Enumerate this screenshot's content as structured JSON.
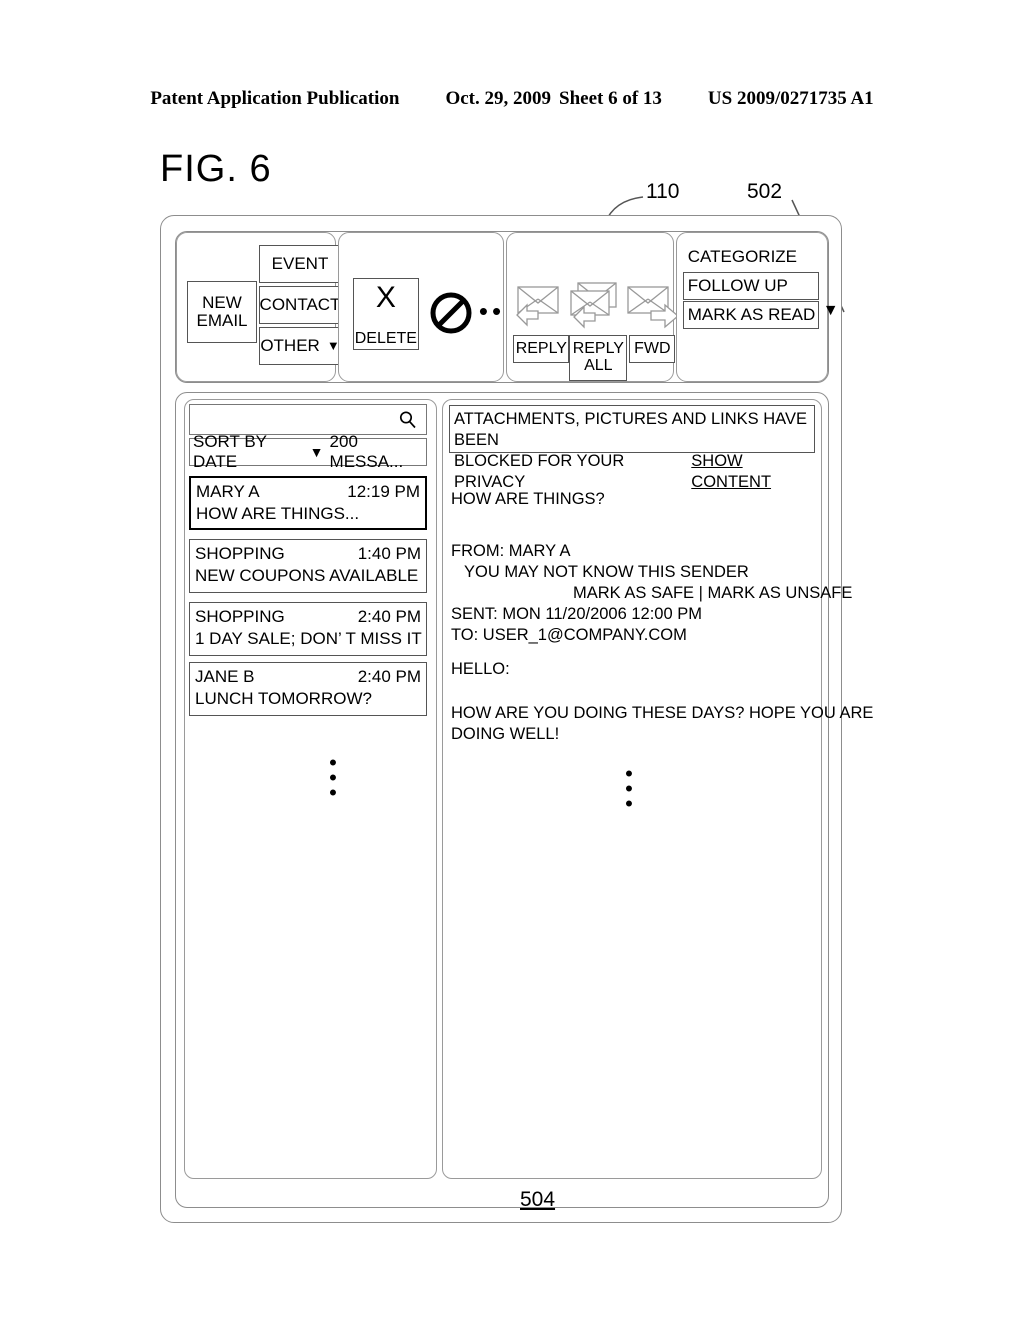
{
  "patent_header": {
    "publication": "Patent Application Publication",
    "date": "Oct. 29, 2009",
    "sheet": "Sheet 6 of 13",
    "number": "US 2009/0271735 A1"
  },
  "figure": {
    "label": "FIG. 6",
    "refs": {
      "device_frame": "110",
      "categorize_dropdown": "502",
      "content_area": "504"
    }
  },
  "ribbon": {
    "new_group": {
      "new_email": "NEW\nEMAIL",
      "new_email_line1": "NEW",
      "new_email_line2": "EMAIL",
      "event": "EVENT",
      "contact": "CONTACT",
      "other": "OTHER",
      "other_caret": "▼"
    },
    "delete_group": {
      "delete_glyph": "X",
      "delete_label": "DELETE",
      "junk_icon": "no-entry-icon",
      "overflow": "•••"
    },
    "reply_group": {
      "reply": "REPLY",
      "reply_all_line1": "REPLY",
      "reply_all_line2": "ALL",
      "fwd": "FWD"
    },
    "categorize_group": {
      "categorize": "CATEGORIZE",
      "follow_up": "FOLLOW UP",
      "mark_as_read": "MARK AS READ",
      "caret": "▼"
    }
  },
  "list_pane": {
    "search_placeholder": "",
    "search_value": "",
    "sort_label": "SORT BY DATE",
    "sort_caret": "▼",
    "count_label": "200 MESSA...",
    "ellipsis": "•\n•\n•",
    "messages": [
      {
        "sender": "MARY A",
        "time": "12:19 PM",
        "preview": "HOW ARE THINGS...",
        "selected": true
      },
      {
        "sender": "SHOPPING",
        "time": "1:40 PM",
        "preview": "NEW COUPONS AVAILABLE",
        "selected": false
      },
      {
        "sender": "SHOPPING",
        "time": "2:40 PM",
        "preview": "1 DAY SALE; DON’   T MISS IT",
        "selected": false
      },
      {
        "sender": "JANE B",
        "time": "2:40 PM",
        "preview": "LUNCH TOMORROW?",
        "selected": false
      }
    ]
  },
  "reading_pane": {
    "blocked_line1": "ATTACHMENTS, PICTURES AND LINKS HAVE BEEN",
    "blocked_line2": "BLOCKED FOR YOUR PRIVACY",
    "show_content": "SHOW CONTENT",
    "subject": "HOW ARE THINGS?",
    "from": "FROM: MARY A",
    "unknown_sender": "YOU MAY NOT KNOW THIS SENDER",
    "mark_safe": "MARK AS SAFE | MARK AS UNSAFE",
    "sent": "SENT: MON 11/20/2006 12:00 PM",
    "to": "TO: USER_1@COMPANY.COM",
    "body_greeting": "HELLO:",
    "body_line1": "HOW ARE YOU DOING THESE DAYS?  HOPE YOU ARE",
    "body_line2": "DOING WELL!",
    "ellipsis": "•\n•\n•"
  },
  "colors": {
    "ink": "#000000",
    "frame": "#8d8d8d",
    "panel_border": "#9a9a9a"
  }
}
